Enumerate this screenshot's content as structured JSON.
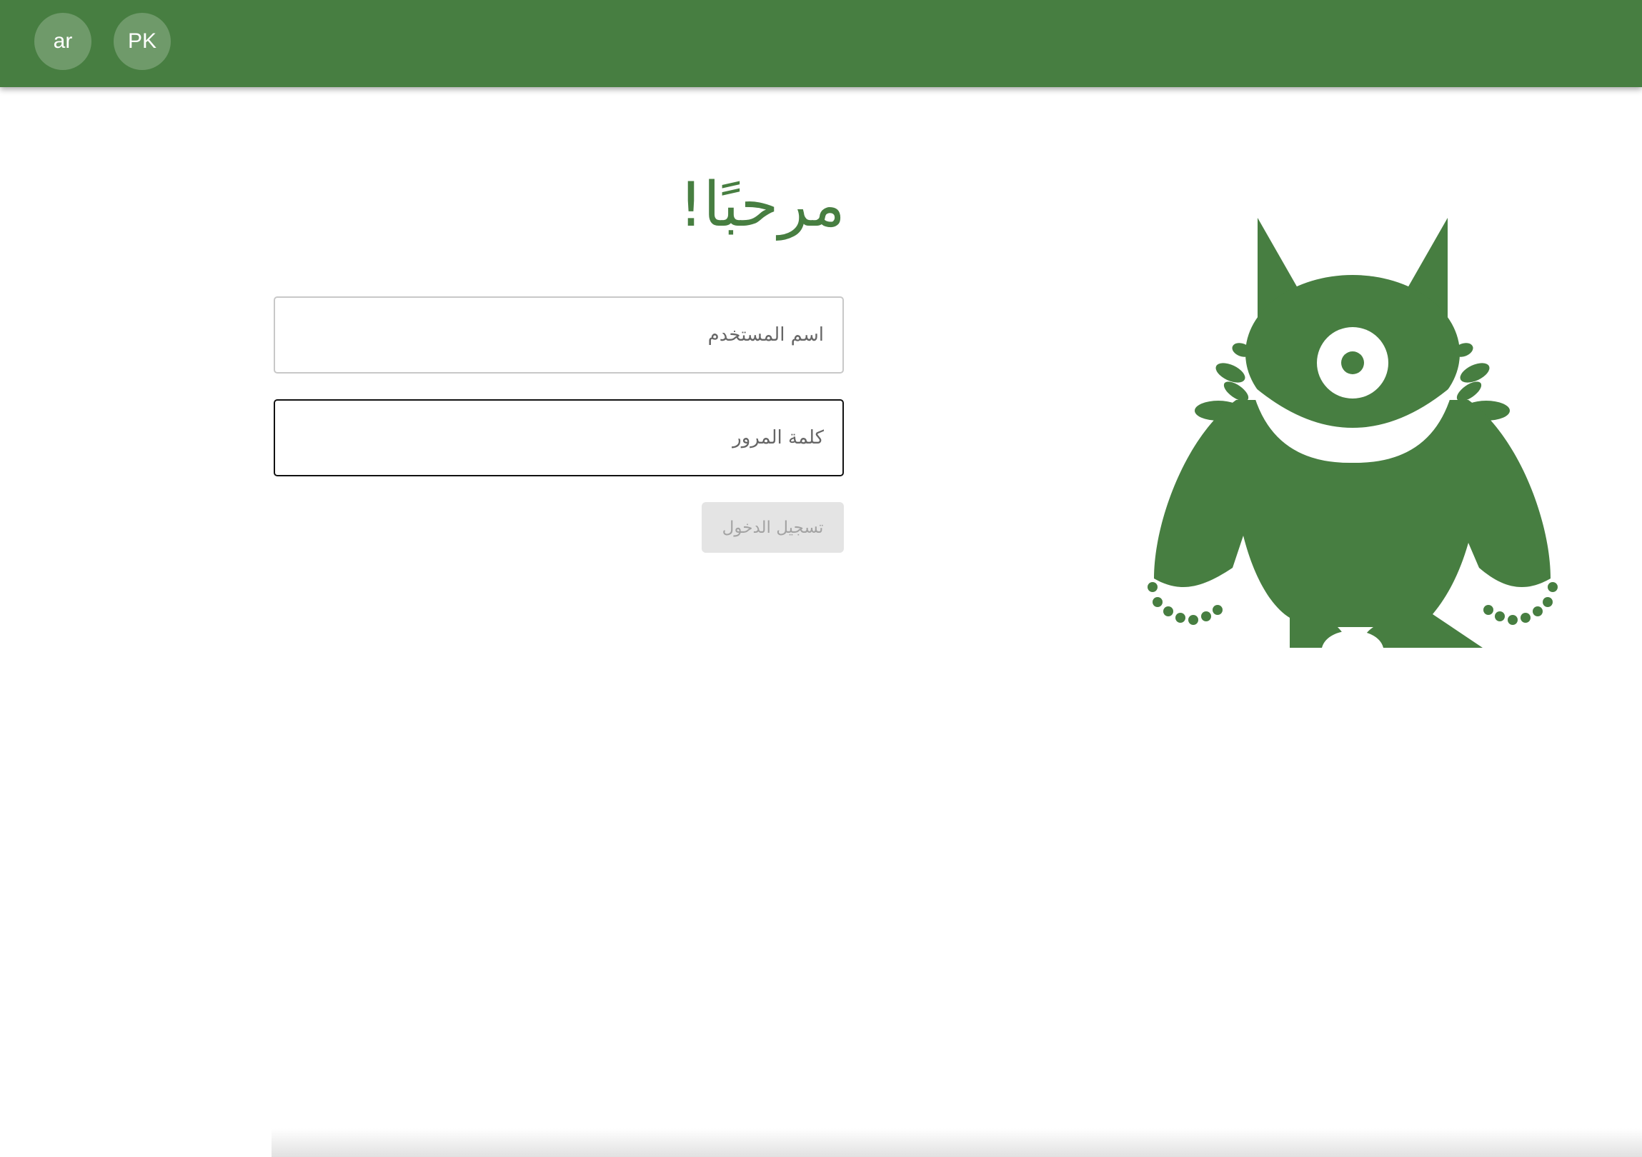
{
  "header": {
    "language_button": "ar",
    "user_button": "PK",
    "bar_color": "#477e41"
  },
  "login": {
    "title": "مرحبًا!",
    "username_placeholder": "اسم المستخدم",
    "password_placeholder": "كلمة المرور",
    "submit_label": "تسجيل الدخول",
    "submit_disabled": true
  },
  "illustration": {
    "icon": "monster-mascot-icon",
    "color": "#477e41"
  }
}
